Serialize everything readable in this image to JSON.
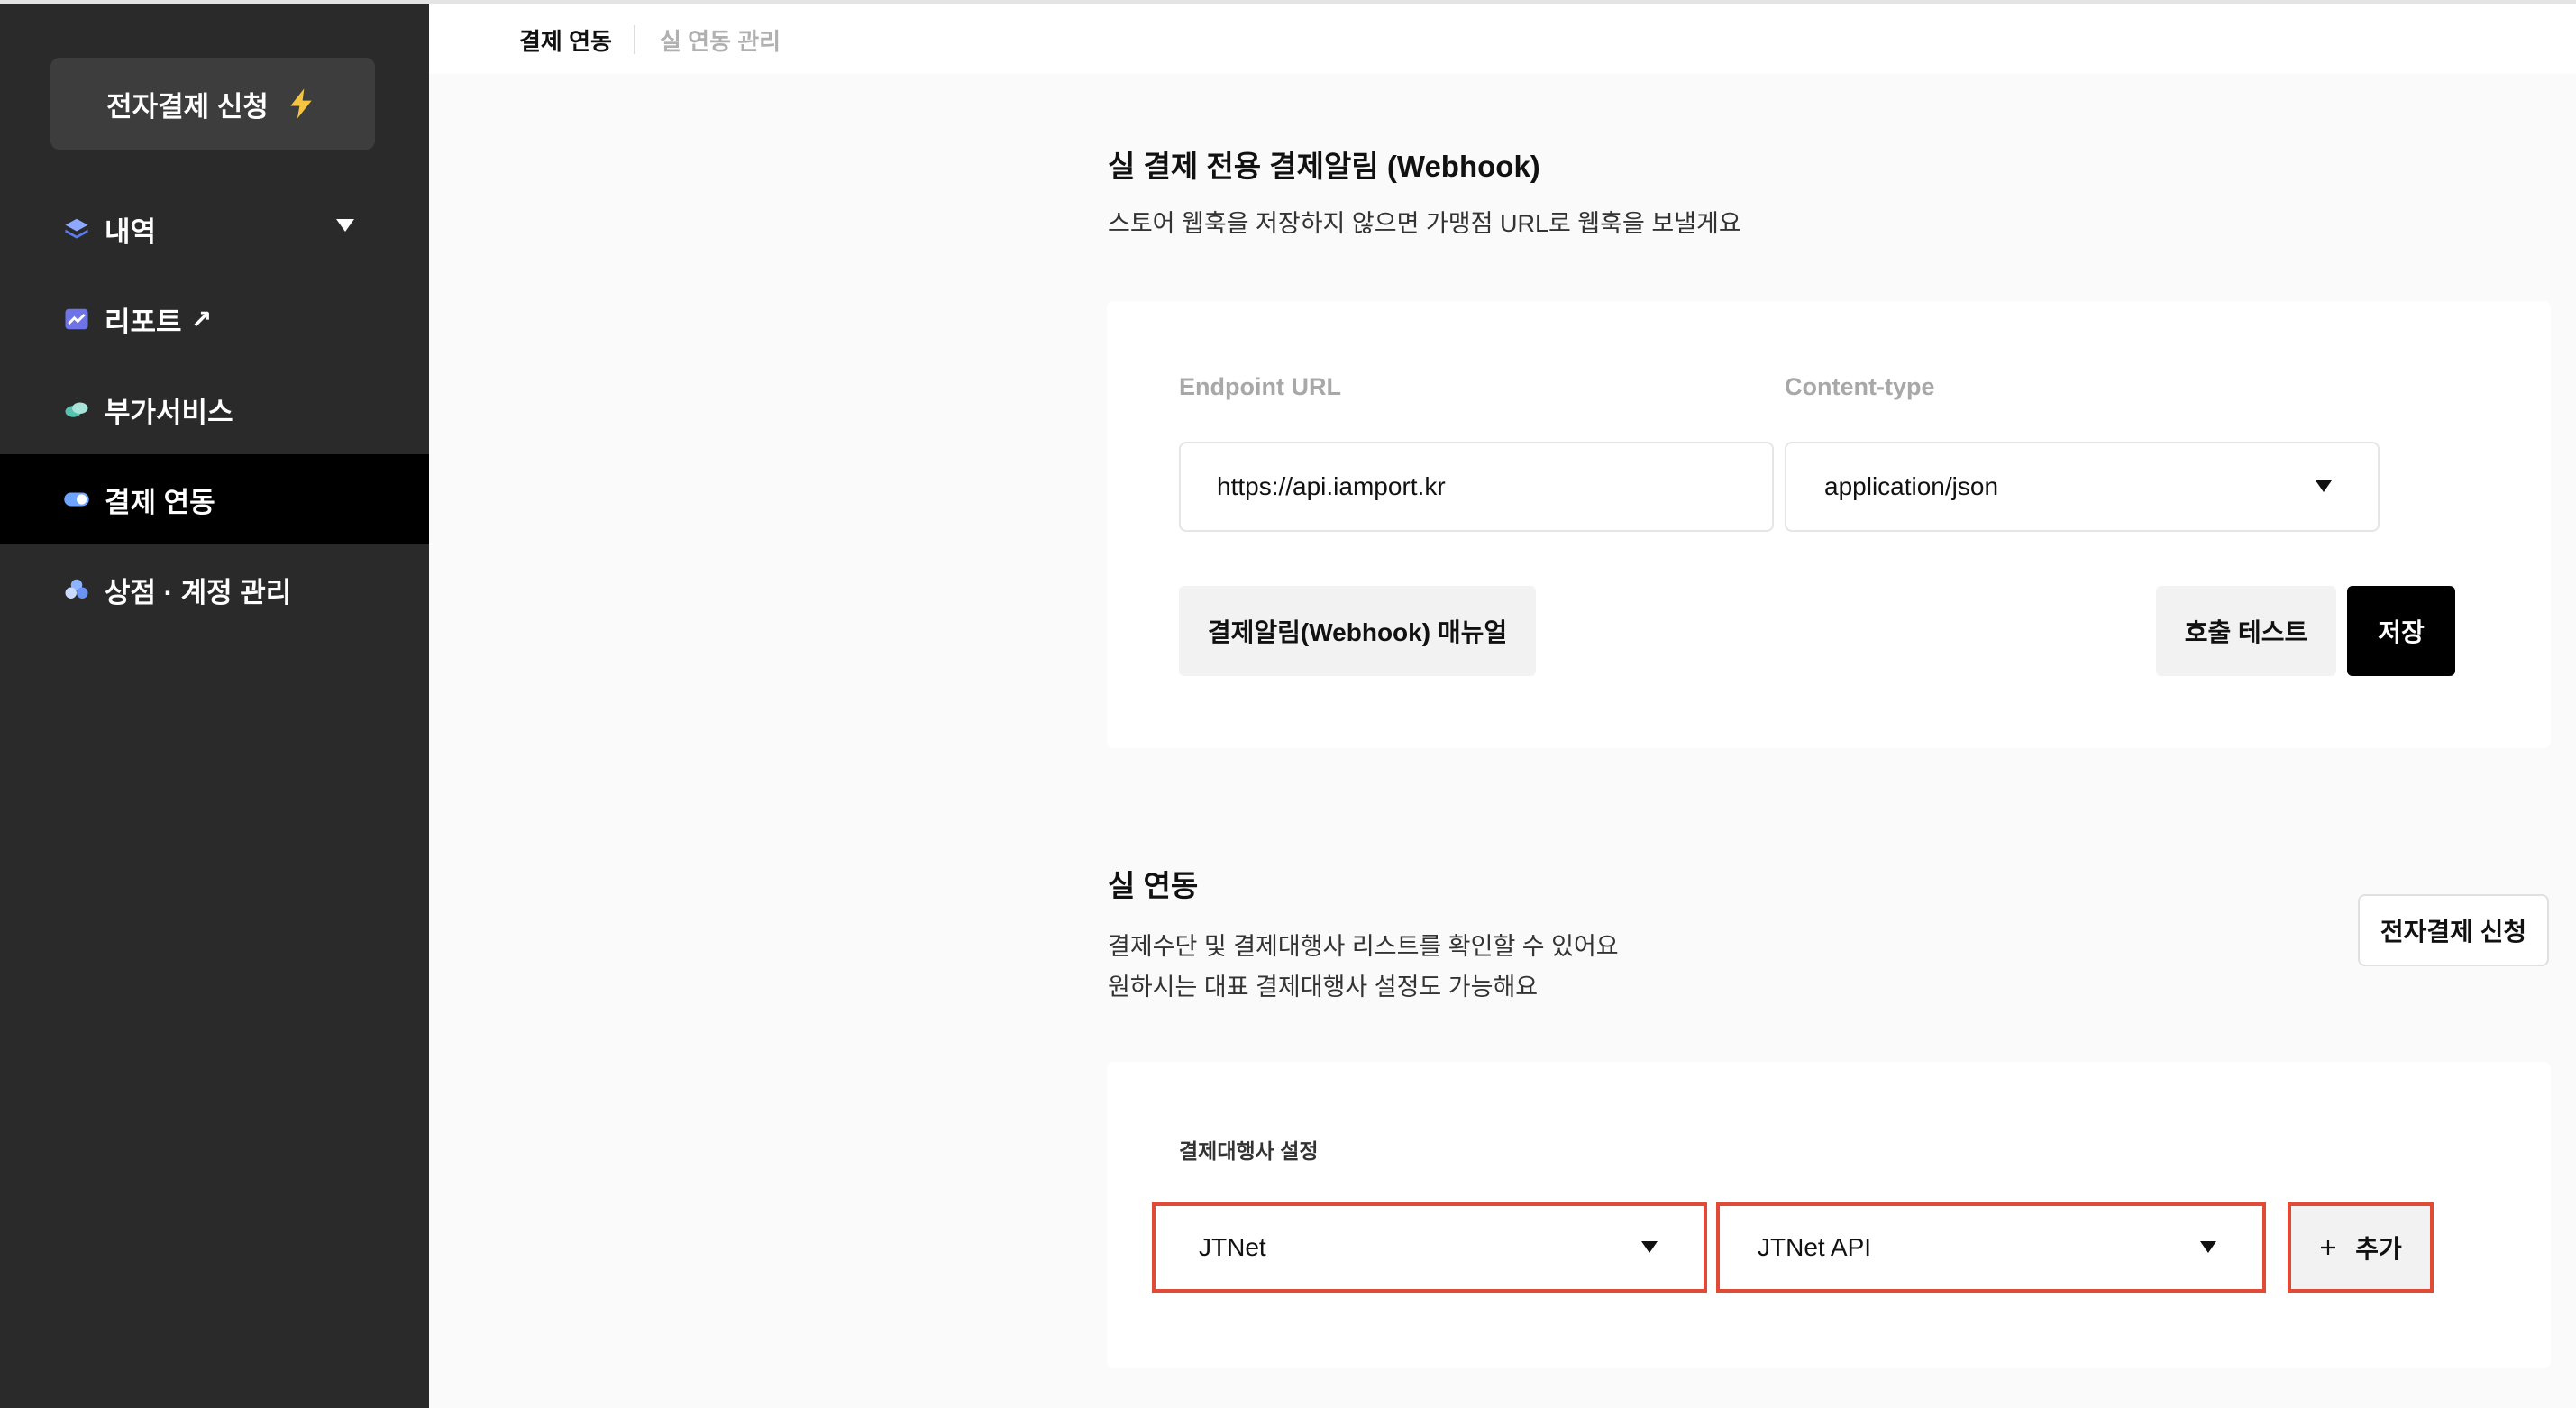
{
  "sidebar": {
    "apply_button": "전자결제 신청",
    "items": [
      {
        "label": "내역",
        "icon": "layers-icon"
      },
      {
        "label": "리포트",
        "icon": "chart-icon"
      },
      {
        "label": "부가서비스",
        "icon": "pills-icon"
      },
      {
        "label": "결제 연동",
        "icon": "toggle-icon",
        "active": true
      },
      {
        "label": "상점 · 계정 관리",
        "icon": "people-icon"
      }
    ],
    "report_suffix": "↗"
  },
  "tabs": [
    {
      "label": "결제 연동",
      "active": true
    },
    {
      "label": "실 연동 관리",
      "active": false
    }
  ],
  "webhook": {
    "title": "실 결제 전용 결제알림 (Webhook)",
    "description": "스토어 웹훅을 저장하지 않으면 가맹점 URL로 웹훅을 보낼게요",
    "endpoint_label": "Endpoint URL",
    "endpoint_value": "https://api.iamport.kr",
    "content_type_label": "Content-type",
    "content_type_value": "application/json",
    "manual_button": "결제알림(Webhook) 매뉴얼",
    "test_button": "호출 테스트",
    "save_button": "저장"
  },
  "live": {
    "title": "실 연동",
    "description_line1": "결제수단 및 결제대행사 리스트를 확인할 수 있어요",
    "description_line2": "원하시는 대표 결제대행사 설정도 가능해요",
    "apply_button": "전자결제 신청",
    "pg_label": "결제대행사 설정",
    "pg_value": "JTNet",
    "module_value": "JTNet API",
    "add_button": "추가"
  },
  "colors": {
    "sidebar_bg": "#2a2a2a",
    "highlight_red": "#e04b36",
    "bolt_yellow": "#f5c542"
  }
}
